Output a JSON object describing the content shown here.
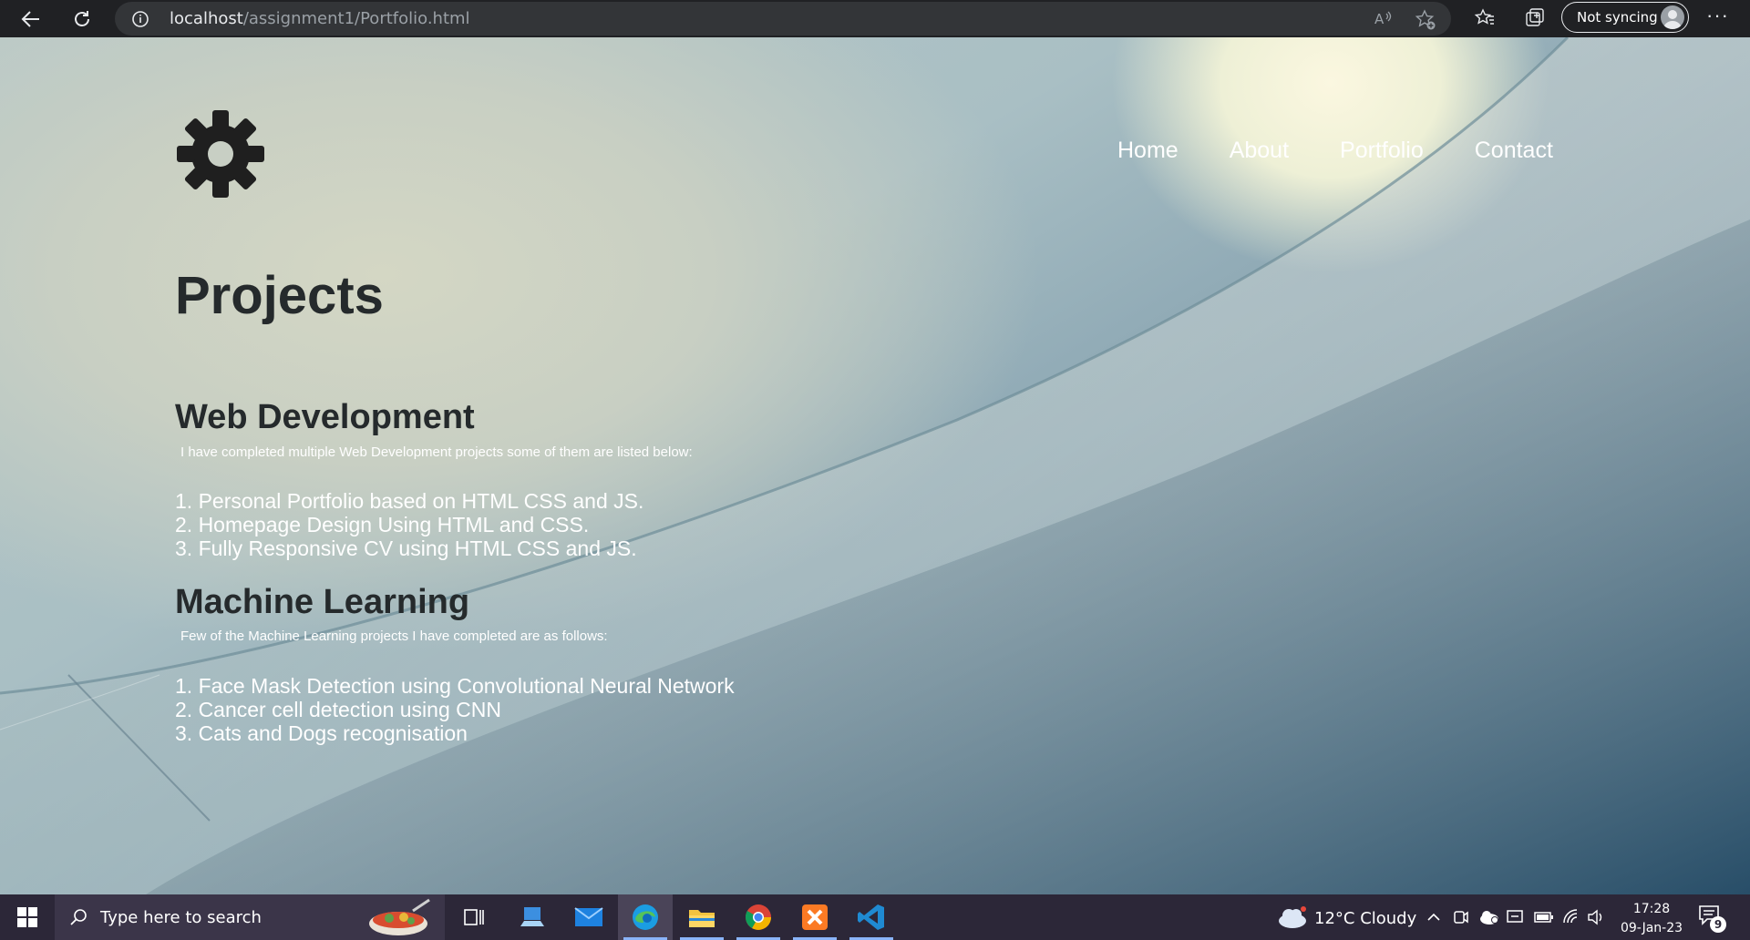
{
  "browser": {
    "url_host": "localhost",
    "url_path": "/assignment1/Portfolio.html",
    "sync_label": "Not syncing",
    "more_label": "···"
  },
  "site": {
    "nav": [
      {
        "label": "Home"
      },
      {
        "label": "About"
      },
      {
        "label": "Portfolio"
      },
      {
        "label": "Contact"
      }
    ],
    "title": "Projects",
    "sections": [
      {
        "heading": "Web Development",
        "description": "I have completed multiple Web Development projects some of them are listed below:",
        "items": [
          "1. Personal Portfolio based on HTML CSS and JS.",
          "2. Homepage Design Using HTML and CSS.",
          "3. Fully Responsive CV using HTML CSS and JS."
        ]
      },
      {
        "heading": "Machine Learning",
        "description": "Few of the Machine Learning projects I have completed are as follows:",
        "items": [
          "1. Face Mask Detection using Convolutional Neural Network",
          "2. Cancer cell detection using CNN",
          "3. Cats and Dogs recognisation"
        ]
      }
    ]
  },
  "taskbar": {
    "search_placeholder": "Type here to search",
    "weather": "12°C  Cloudy",
    "time": "17:28",
    "date": "09-Jan-23",
    "notification_count": "9"
  },
  "colors": {
    "chrome_bg": "#202124",
    "taskbar_bg": "#2c2738",
    "heading": "#252a2c",
    "body_text": "#ffffff"
  }
}
